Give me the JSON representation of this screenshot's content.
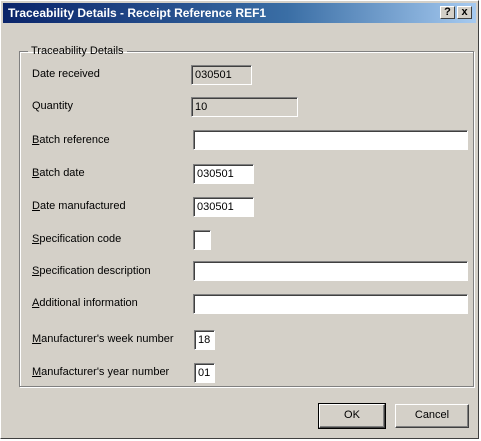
{
  "window": {
    "title": "Traceability Details - Receipt Reference REF1"
  },
  "titlebar_buttons": {
    "help": "?",
    "close": "x"
  },
  "group": {
    "legend": "Traceability Details"
  },
  "fields": [
    {
      "key": "date_received",
      "hotkey": "",
      "label_rest": "Date received",
      "value": "030501",
      "readonly": true
    },
    {
      "key": "quantity",
      "hotkey": "",
      "label_rest": "Quantity",
      "value": "10",
      "readonly": true
    },
    {
      "key": "batch_reference",
      "hotkey": "B",
      "label_rest": "atch reference",
      "value": "",
      "readonly": false
    },
    {
      "key": "batch_date",
      "hotkey": "B",
      "label_rest": "atch date",
      "value": "030501",
      "readonly": false
    },
    {
      "key": "date_manufactured",
      "hotkey": "D",
      "label_rest": "ate manufactured",
      "value": "030501",
      "readonly": false
    },
    {
      "key": "specification_code",
      "hotkey": "S",
      "label_rest": "pecification code",
      "value": "",
      "readonly": false
    },
    {
      "key": "specification_description",
      "hotkey": "S",
      "label_rest": "pecification description",
      "value": "",
      "readonly": false
    },
    {
      "key": "additional_information",
      "hotkey": "A",
      "label_rest": "dditional information",
      "value": "",
      "readonly": false
    },
    {
      "key": "manufacturers_week_number",
      "hotkey": "M",
      "label_rest": "anufacturer's week number",
      "value": "18",
      "readonly": false
    },
    {
      "key": "manufacturers_year_number",
      "hotkey": "M",
      "label_rest": "anufacturer's year number",
      "value": "01",
      "readonly": false
    }
  ],
  "buttons": {
    "ok": "OK",
    "cancel": "Cancel"
  }
}
